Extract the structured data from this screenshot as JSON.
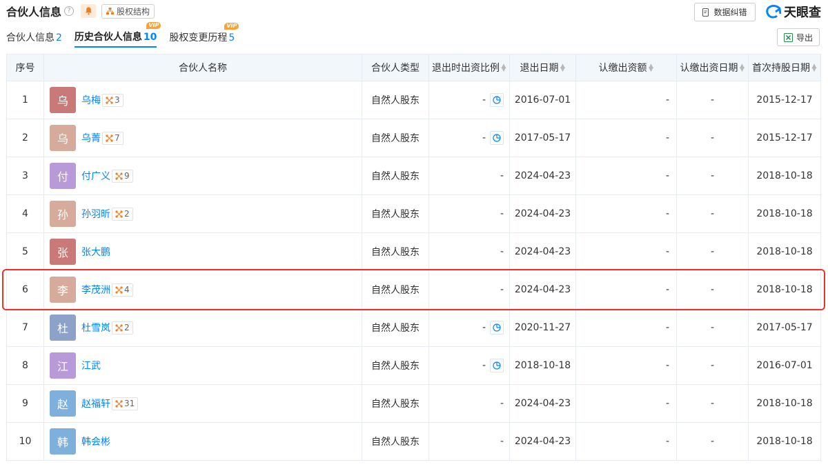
{
  "header": {
    "title": "合伙人信息",
    "help_icon": "?",
    "struct_btn": "股权结构",
    "err_btn": "数据纠错",
    "export_btn": "导出",
    "brand": "天眼查"
  },
  "tabs": [
    {
      "label": "合伙人信息",
      "count": "2",
      "vip": ""
    },
    {
      "label": "历史合伙人信息",
      "count": "10",
      "vip": "VIP"
    },
    {
      "label": "股权变更历程",
      "count": "5",
      "vip": "VIP"
    }
  ],
  "columns": {
    "idx": "序号",
    "name": "合伙人名称",
    "type": "合伙人类型",
    "ratio": "退出时出资比例",
    "exit_date": "退出日期",
    "amount": "认缴出资额",
    "amount_date": "认缴出资日期",
    "first_date": "首次持股日期"
  },
  "colors": {
    "accent": "#0084ff",
    "header_bg": "#f2f7fc",
    "highlight": "#e8332b"
  },
  "rows": [
    {
      "idx": "1",
      "avatar": "乌",
      "avatar_color": "#c97a78",
      "name": "乌梅",
      "rel": "3",
      "type": "自然人股东",
      "ratio": "-",
      "chart": true,
      "exit_date": "2016-07-01",
      "amount": "-",
      "amount_date": "-",
      "first_date": "2015-12-17"
    },
    {
      "idx": "2",
      "avatar": "乌",
      "avatar_color": "#d6ab9c",
      "name": "乌菁",
      "rel": "7",
      "type": "自然人股东",
      "ratio": "-",
      "chart": true,
      "exit_date": "2017-05-17",
      "amount": "-",
      "amount_date": "-",
      "first_date": "2015-12-17"
    },
    {
      "idx": "3",
      "avatar": "付",
      "avatar_color": "#b99ad9",
      "name": "付广义",
      "rel": "9",
      "type": "自然人股东",
      "ratio": "-",
      "chart": false,
      "exit_date": "2024-04-23",
      "amount": "-",
      "amount_date": "-",
      "first_date": "2018-10-18"
    },
    {
      "idx": "4",
      "avatar": "孙",
      "avatar_color": "#d6ab9c",
      "name": "孙羽昕",
      "rel": "2",
      "type": "自然人股东",
      "ratio": "-",
      "chart": false,
      "exit_date": "2024-04-23",
      "amount": "-",
      "amount_date": "-",
      "first_date": "2018-10-18"
    },
    {
      "idx": "5",
      "avatar": "张",
      "avatar_color": "#c97a78",
      "name": "张大鹏",
      "rel": "",
      "type": "自然人股东",
      "ratio": "-",
      "chart": false,
      "exit_date": "2024-04-23",
      "amount": "-",
      "amount_date": "-",
      "first_date": "2018-10-18"
    },
    {
      "idx": "6",
      "avatar": "李",
      "avatar_color": "#d6ab9c",
      "name": "李茂洲",
      "rel": "4",
      "type": "自然人股东",
      "ratio": "-",
      "chart": false,
      "exit_date": "2024-04-23",
      "amount": "-",
      "amount_date": "-",
      "first_date": "2018-10-18"
    },
    {
      "idx": "7",
      "avatar": "杜",
      "avatar_color": "#8da2c9",
      "name": "杜雪岚",
      "rel": "2",
      "type": "自然人股东",
      "ratio": "-",
      "chart": true,
      "exit_date": "2020-11-27",
      "amount": "-",
      "amount_date": "-",
      "first_date": "2017-05-17"
    },
    {
      "idx": "8",
      "avatar": "江",
      "avatar_color": "#b99ad9",
      "name": "江武",
      "rel": "",
      "type": "自然人股东",
      "ratio": "-",
      "chart": true,
      "exit_date": "2018-10-18",
      "amount": "-",
      "amount_date": "-",
      "first_date": "2016-07-01"
    },
    {
      "idx": "9",
      "avatar": "赵",
      "avatar_color": "#7fb0db",
      "name": "赵福轩",
      "rel": "31",
      "type": "自然人股东",
      "ratio": "-",
      "chart": false,
      "exit_date": "2024-04-23",
      "amount": "-",
      "amount_date": "-",
      "first_date": "2018-10-18"
    },
    {
      "idx": "10",
      "avatar": "韩",
      "avatar_color": "#7fb0db",
      "name": "韩会彬",
      "rel": "",
      "type": "自然人股东",
      "ratio": "-",
      "chart": false,
      "exit_date": "2024-04-23",
      "amount": "-",
      "amount_date": "-",
      "first_date": "2018-10-18"
    }
  ]
}
